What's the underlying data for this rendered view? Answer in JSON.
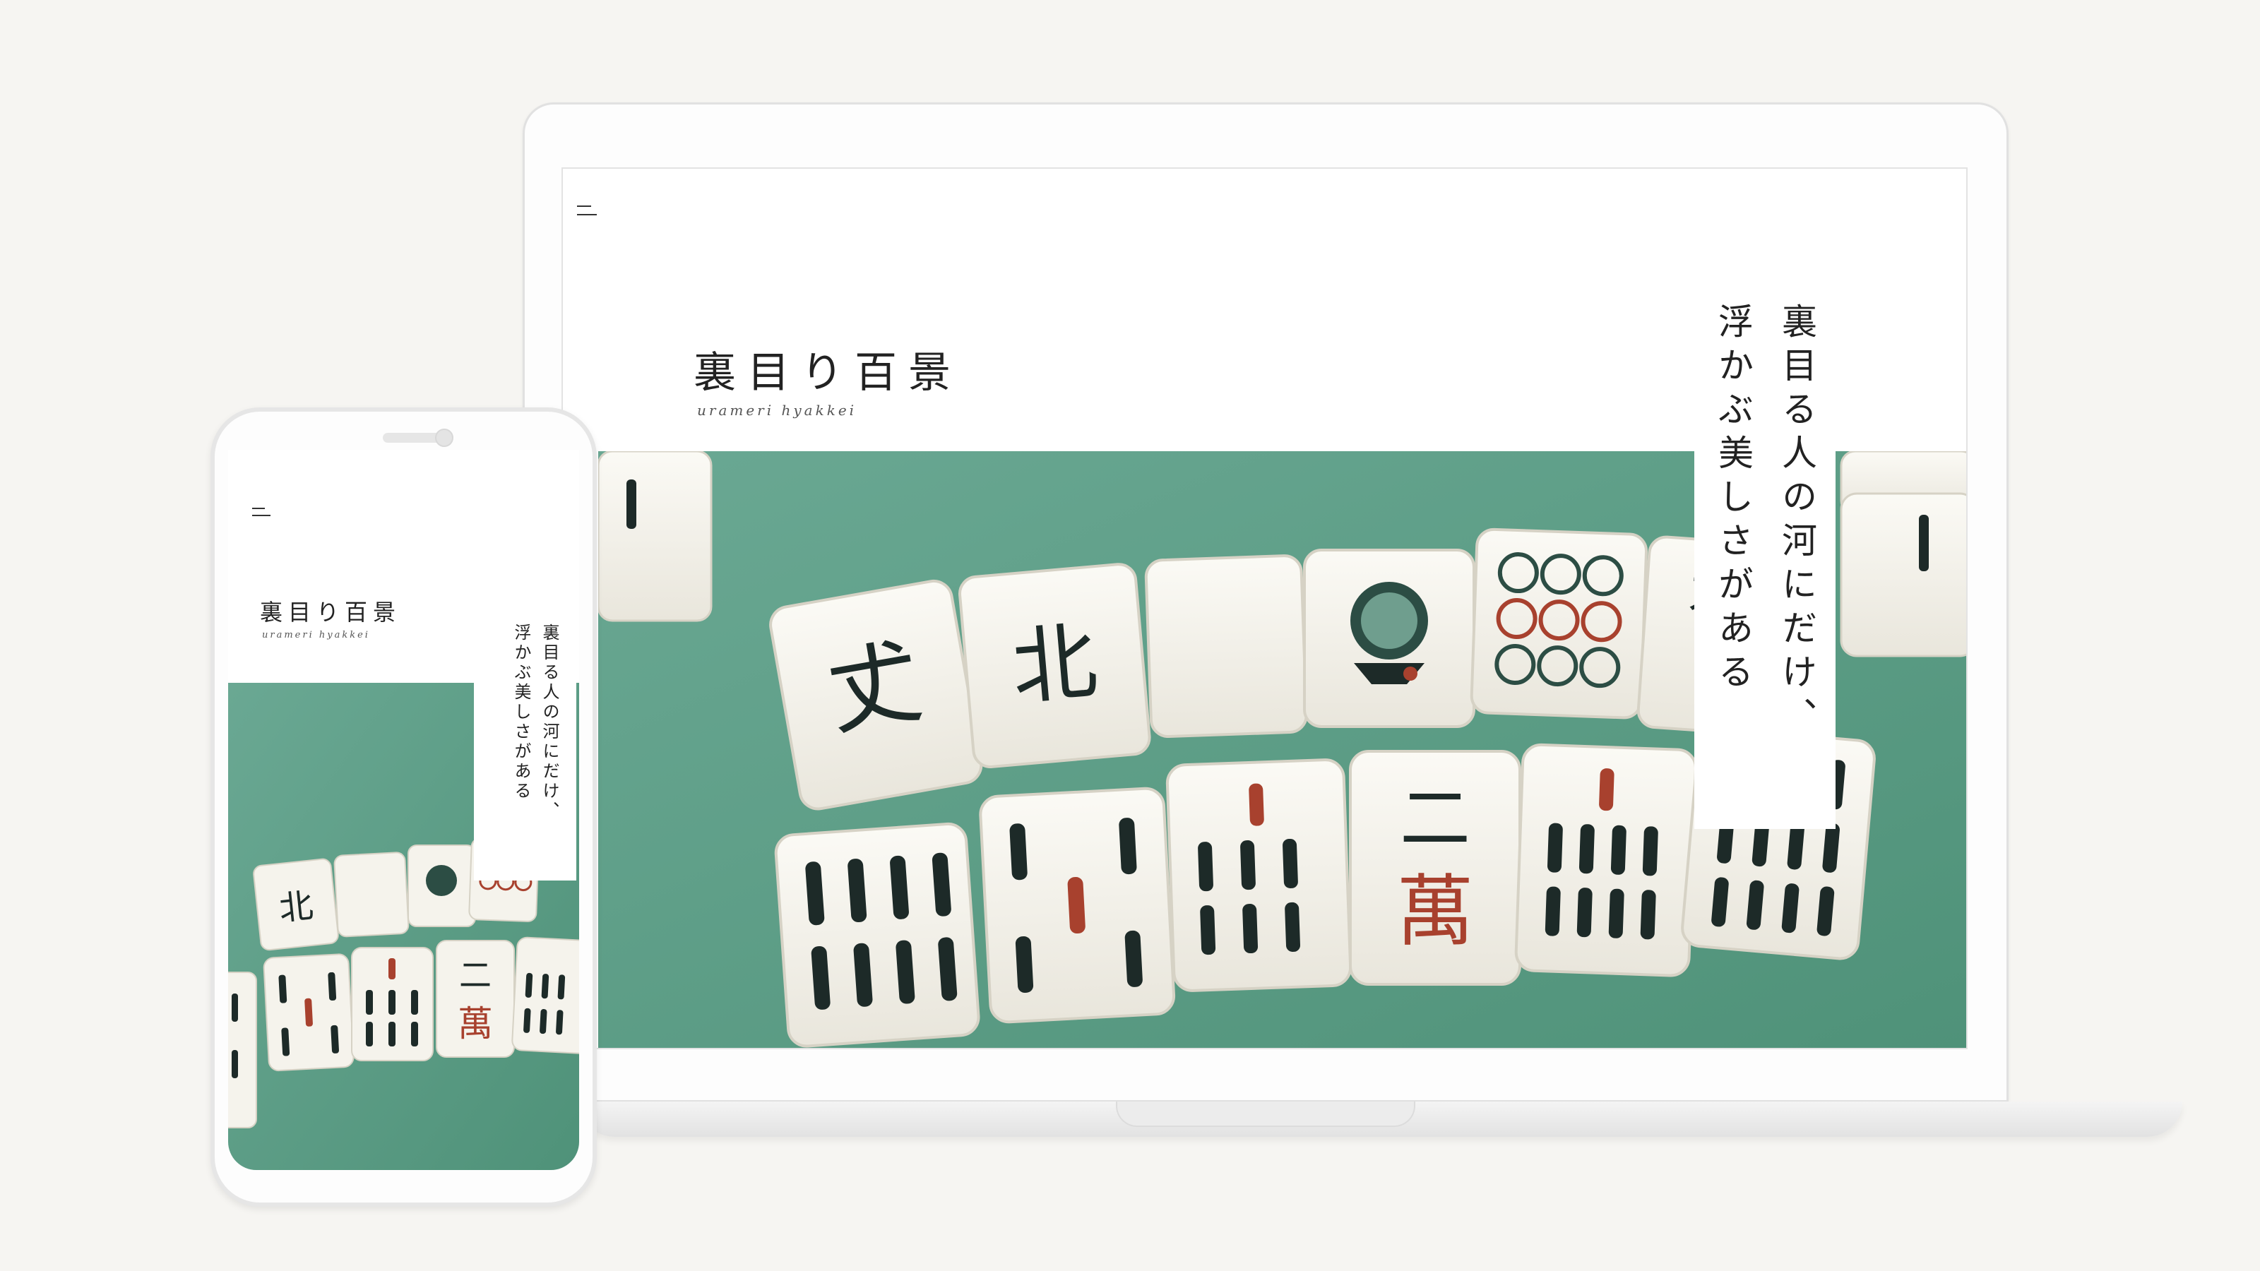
{
  "site": {
    "logo": "裏目り百景",
    "logo_romaji": "urameri hyakkei",
    "tagline_line1": "裏目る人の河にだけ、",
    "tagline_line2": "浮かぶ美しさがある",
    "menu_icon": "menu-icon"
  },
  "tiles": {
    "north": "北",
    "two": "二",
    "nine": "九",
    "man": "萬",
    "one": "一"
  },
  "colors": {
    "background": "#f6f5f2",
    "felt": "#5fa28a",
    "tile": "#f3f1ea",
    "ink": "#1d2a28",
    "red": "#a8412e"
  }
}
